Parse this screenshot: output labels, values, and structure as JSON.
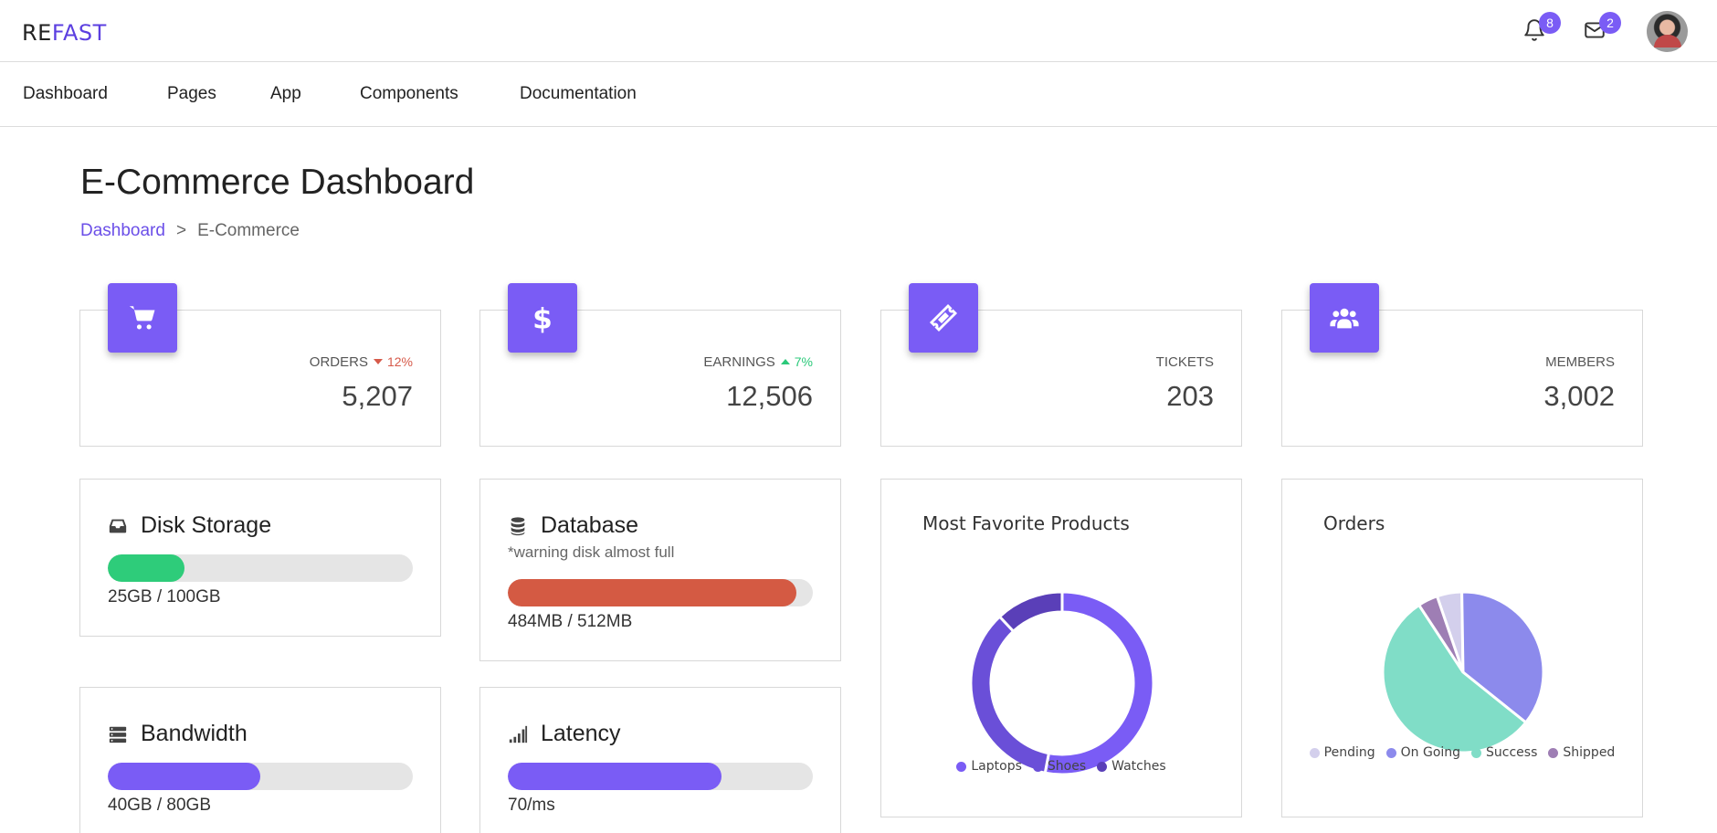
{
  "brand": {
    "logo_prefix": "RE",
    "logo_accent": "FAST"
  },
  "top": {
    "notifications_count": "8",
    "messages_count": "2"
  },
  "nav": [
    "Dashboard",
    "Pages",
    "App",
    "Components",
    "Documentation"
  ],
  "page": {
    "title": "E-Commerce Dashboard",
    "breadcrumb": {
      "link": "Dashboard",
      "separator": ">",
      "current": "E-Commerce"
    }
  },
  "stats": [
    {
      "label": "ORDERS",
      "trend": "12%",
      "trend_dir": "down",
      "value": "5,207",
      "icon": "cart-icon"
    },
    {
      "label": "EARNINGS",
      "trend": "7%",
      "trend_dir": "up",
      "value": "12,506",
      "icon": "dollar-icon"
    },
    {
      "label": "TICKETS",
      "trend": "",
      "value": "203",
      "icon": "ticket-icon"
    },
    {
      "label": "MEMBERS",
      "trend": "",
      "value": "3,002",
      "icon": "users-icon"
    }
  ],
  "resources": {
    "disk": {
      "title": "Disk Storage",
      "value": "25GB / 100GB",
      "percent": 25,
      "color": "#2ecc7a"
    },
    "database": {
      "title": "Database",
      "note": "*warning disk almost full",
      "value": "484MB / 512MB",
      "percent": 94.5,
      "color": "#d45a43"
    },
    "bandwidth": {
      "title": "Bandwidth",
      "value": "40GB / 80GB",
      "percent": 50,
      "color": "#7a5cf5"
    },
    "latency": {
      "title": "Latency",
      "value": "70/ms",
      "percent": 70,
      "color": "#7a5cf5"
    }
  },
  "colors": {
    "accent": "#7a5cf5",
    "brand": "#5b3fe0"
  },
  "chart_data": [
    {
      "type": "pie",
      "variant": "donut",
      "title": "Most Favorite Products",
      "categories": [
        "Laptops",
        "Shoes",
        "Watches"
      ],
      "values": [
        53,
        35,
        12
      ],
      "colors": [
        "#7a5cf5",
        "#6a4fd8",
        "#5a3fb8"
      ],
      "legend": "bottom"
    },
    {
      "type": "pie",
      "title": "Orders",
      "categories": [
        "Pending",
        "On Going",
        "Success",
        "Shipped"
      ],
      "values": [
        5,
        36,
        55,
        4
      ],
      "colors": [
        "#d3cfec",
        "#8c8aec",
        "#80ddc7",
        "#9e7eb4"
      ],
      "legend": "bottom"
    }
  ]
}
